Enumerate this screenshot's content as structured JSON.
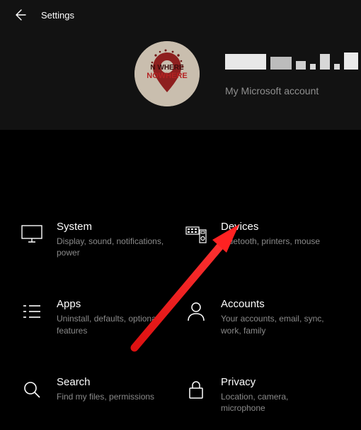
{
  "header": {
    "title": "Settings",
    "account_subtext": "My Microsoft account"
  },
  "tiles": [
    {
      "title": "System",
      "desc": "Display, sound, notifications, power"
    },
    {
      "title": "Devices",
      "desc": "Bluetooth, printers, mouse"
    },
    {
      "title": "Apps",
      "desc": "Uninstall, defaults, optional features"
    },
    {
      "title": "Accounts",
      "desc": "Your accounts, email, sync, work, family"
    },
    {
      "title": "Search",
      "desc": "Find my files, permissions"
    },
    {
      "title": "Privacy",
      "desc": "Location, camera, microphone"
    }
  ]
}
